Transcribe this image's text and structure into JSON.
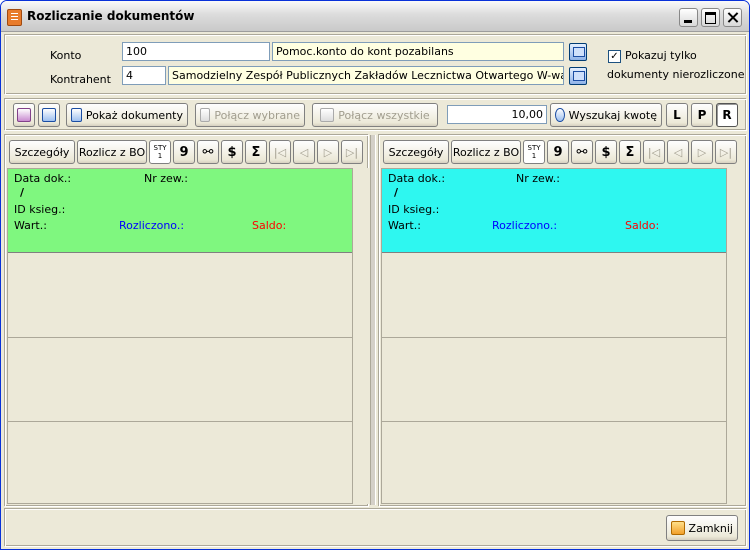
{
  "window": {
    "title": "Rozliczanie dokumentów"
  },
  "form": {
    "konto_label": "Konto",
    "konto_value": "100",
    "konto_desc": "Pomoc.konto do kont pozabilans",
    "kontrahent_label": "Kontrahent",
    "kontrahent_value": "4",
    "kontrahent_desc": "Samodzielny Zespół Publicznych Zakładów Lecznictwa Otwartego W-wa Wawer",
    "show_unsettled_line1": "Pokazuj tylko",
    "show_unsettled_line2": "dokumenty nierozliczone",
    "show_unsettled_checked": "✓"
  },
  "toolbar": {
    "pokaz_dokumenty": "Pokaż dokumenty",
    "polacz_wybrane": "Połącz wybrane",
    "polacz_wszystkie": "Połącz wszystkie",
    "amount": "10,00",
    "wyszukaj_kwote": "Wyszukaj kwotę",
    "letters": [
      "L",
      "P",
      "R"
    ]
  },
  "left_pane": {
    "szczegoly": "Szczegóły",
    "rozlicz_bo": "Rozlicz z BO",
    "sty_top": "STY",
    "sty_bottom": "1",
    "nine": "9",
    "dollar": "$",
    "sigma": "Σ",
    "card_color": "#7ff77f",
    "data_dok": "Data dok.:",
    "nr_zew": "Nr zew.:",
    "slash": "/",
    "id_ksieg": "ID ksieg.:",
    "wart": "Wart.:",
    "rozliczono": "Rozliczono.:",
    "saldo": "Saldo:"
  },
  "right_pane": {
    "szczegoly": "Szczegóły",
    "rozlicz_bo": "Rozlicz z BO",
    "sty_top": "STY",
    "sty_bottom": "1",
    "nine": "9",
    "dollar": "$",
    "sigma": "Σ",
    "card_color": "#2ef7f0",
    "data_dok": "Data dok.:",
    "nr_zew": "Nr zew.:",
    "slash": "/",
    "id_ksieg": "ID ksieg.:",
    "wart": "Wart.:",
    "rozliczono": "Rozliczono.:",
    "saldo": "Saldo:"
  },
  "footer": {
    "zamknij": "Zamknij"
  }
}
